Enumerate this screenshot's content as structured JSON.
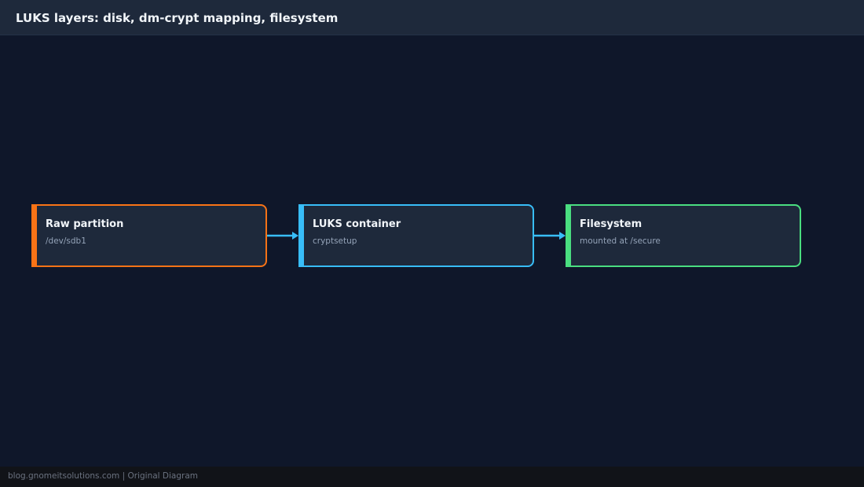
{
  "header": {
    "title": "LUKS layers: disk, dm-crypt mapping, filesystem"
  },
  "diagram": {
    "nodes": [
      {
        "title": "Raw partition",
        "subtitle": "/dev/sdb1",
        "accent": "#f97316"
      },
      {
        "title": "LUKS container",
        "subtitle": "cryptsetup",
        "accent": "#38bdf8"
      },
      {
        "title": "Filesystem",
        "subtitle": "mounted at /secure",
        "accent": "#4ade80"
      }
    ],
    "edges": [
      {
        "from": 0,
        "to": 1
      },
      {
        "from": 1,
        "to": 2
      }
    ],
    "edge_color": "#38bdf8",
    "background": "#0f172a",
    "node_fill": "#1e293b"
  },
  "footer": {
    "text": "blog.gnomeitsolutions.com | Original Diagram"
  }
}
